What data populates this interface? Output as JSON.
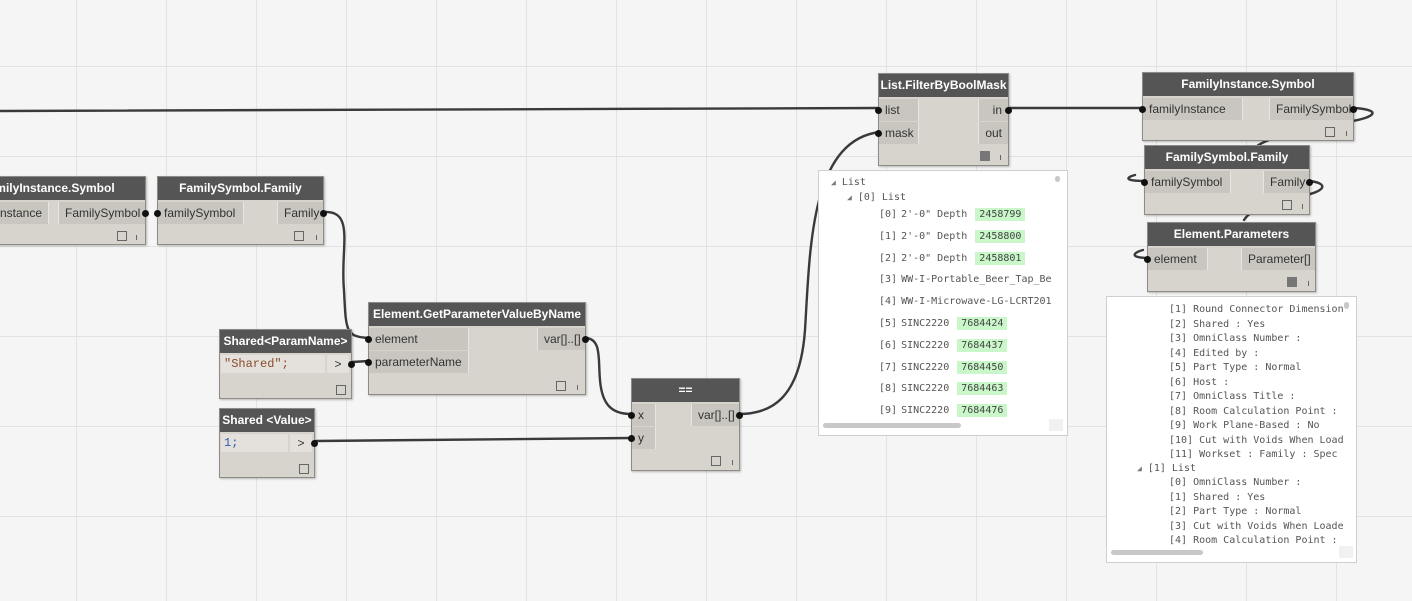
{
  "nodes": {
    "fi_symbol_left": {
      "title": "FamilyInstance.Symbol",
      "input": "familyInstance",
      "output": "FamilySymbol"
    },
    "fs_family_left": {
      "title": "FamilySymbol.Family",
      "input": "familySymbol",
      "output": "Family"
    },
    "param_name": {
      "title": "Shared<ParamName>",
      "code": "\"Shared\";",
      "gt": ">"
    },
    "value": {
      "title": "Shared <Value>",
      "code": "1;",
      "gt": ">"
    },
    "get_param": {
      "title": "Element.GetParameterValueByName",
      "input1": "element",
      "input2": "parameterName",
      "output": "var[]..[]"
    },
    "equals": {
      "title": "==",
      "input1": "x",
      "input2": "y",
      "output": "var[]..[]"
    },
    "filter": {
      "title": "List.FilterByBoolMask",
      "input1": "list",
      "input2": "mask",
      "output1": "in",
      "output2": "out"
    },
    "fi_symbol_right": {
      "title": "FamilyInstance.Symbol",
      "input": "familyInstance",
      "output": "FamilySymbol"
    },
    "fs_family_right": {
      "title": "FamilySymbol.Family",
      "input": "familySymbol",
      "output": "Family"
    },
    "elem_params": {
      "title": "Element.Parameters",
      "input": "element",
      "output": "Parameter[]"
    }
  },
  "filter_preview": {
    "root": "List",
    "sub": "[0] List",
    "items": [
      {
        "idx": "[0]",
        "text": "2'-0\" Depth",
        "id": "2458799"
      },
      {
        "idx": "[1]",
        "text": "2'-0\" Depth",
        "id": "2458800"
      },
      {
        "idx": "[2]",
        "text": "2'-0\" Depth",
        "id": "2458801"
      },
      {
        "idx": "[3]",
        "text": "WW-I-Portable_Beer_Tap_Be",
        "id": ""
      },
      {
        "idx": "[4]",
        "text": "WW-I-Microwave-LG-LCRT201",
        "id": ""
      },
      {
        "idx": "[5]",
        "text": "SINC2220",
        "id": "7684424"
      },
      {
        "idx": "[6]",
        "text": "SINC2220",
        "id": "7684437"
      },
      {
        "idx": "[7]",
        "text": "SINC2220",
        "id": "7684450"
      },
      {
        "idx": "[8]",
        "text": "SINC2220",
        "id": "7684463"
      },
      {
        "idx": "[9]",
        "text": "SINC2220",
        "id": "7684476"
      }
    ]
  },
  "params_preview": {
    "lines_a": [
      "[1] Round Connector Dimension",
      "[2] Shared : Yes",
      "[3] OmniClass Number :",
      "[4] Edited by :",
      "[5] Part Type : Normal",
      "[6] Host :",
      "[7] OmniClass Title :",
      "[8] Room Calculation Point :",
      "[9] Work Plane-Based : No",
      "[10] Cut with Voids When Load",
      "[11] Workset : Family  : Spec"
    ],
    "sub": "[1] List",
    "lines_b": [
      "[0] OmniClass Number :",
      "[1] Shared : Yes",
      "[2] Part Type : Normal",
      "[3] Cut with Voids When Loade",
      "[4] Room Calculation Point :"
    ]
  },
  "colors": {
    "header": "#555555",
    "node_body": "#d7d4ce",
    "highlight": "#c9f7c9",
    "wire": "#333333"
  }
}
